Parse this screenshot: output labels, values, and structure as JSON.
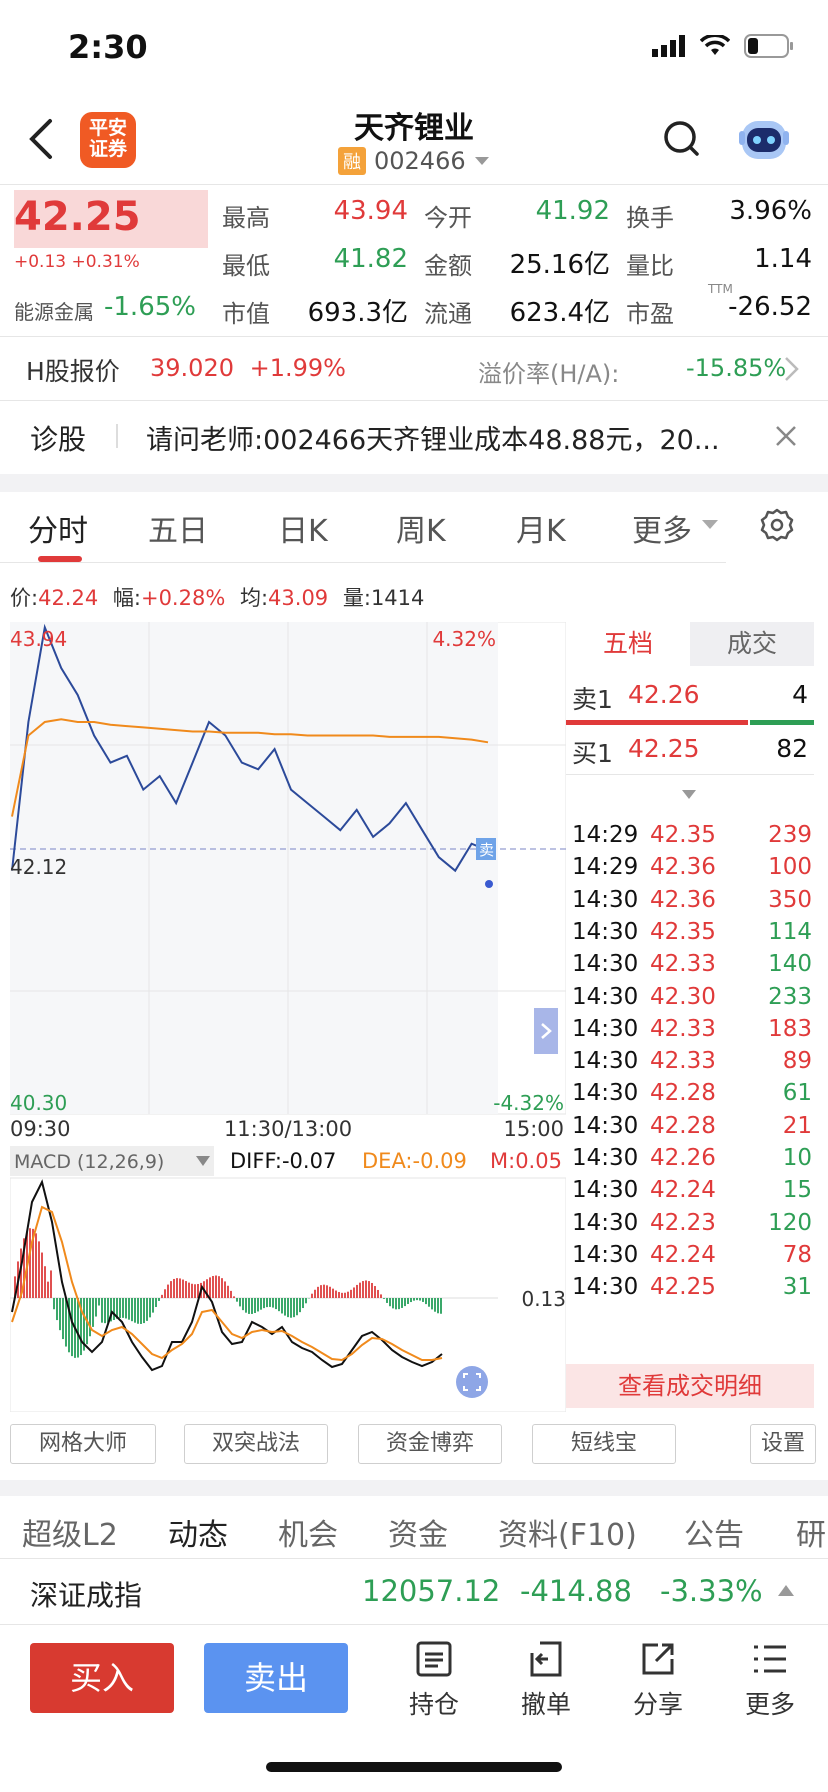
{
  "status": {
    "time": "2:30"
  },
  "header": {
    "title": "天齐锂业",
    "badge": "融",
    "code": "002466",
    "logo_line1": "平安",
    "logo_line2": "证券"
  },
  "quote": {
    "price": "42.25",
    "change": "+0.13 +0.31%",
    "sector_label": "能源金属",
    "sector_change": "-1.65%",
    "stats": [
      {
        "label": "最高",
        "value": "43.94",
        "color": "red"
      },
      {
        "label": "今开",
        "value": "41.92",
        "color": "green"
      },
      {
        "label": "换手",
        "value": "3.96%",
        "color": "black"
      },
      {
        "label": "最低",
        "value": "41.82",
        "color": "green"
      },
      {
        "label": "金额",
        "value": "25.16亿",
        "color": "black"
      },
      {
        "label": "量比",
        "value": "1.14",
        "color": "black"
      },
      {
        "label": "市值",
        "value": "693.3亿",
        "color": "black"
      },
      {
        "label": "流通",
        "value": "623.4亿",
        "color": "black"
      },
      {
        "label": "市盈",
        "value": "-26.52",
        "color": "black"
      }
    ],
    "pe_sup": "TTM"
  },
  "hshare": {
    "label": "H股报价",
    "price": "39.020",
    "change": "+1.99%",
    "premium_label": "溢价率(H/A):",
    "premium": "-15.85%"
  },
  "diagnosis": {
    "label": "诊股",
    "text": "请问老师:002466天齐锂业成本48.88元，20..."
  },
  "tabs": [
    "分时",
    "五日",
    "日K",
    "周K",
    "月K",
    "更多"
  ],
  "info_line": {
    "price_label": "价:",
    "price": "42.24",
    "amp_label": "幅:",
    "amp": "+0.28%",
    "avg_label": "均:",
    "avg": "43.09",
    "vol_label": "量:",
    "vol": "1414"
  },
  "chart": {
    "high": "43.94",
    "low": "40.30",
    "mid": "42.12",
    "pct_high": "4.32%",
    "pct_low": "-4.32%",
    "x_start": "09:30",
    "x_mid": "11:30/13:00",
    "x_end": "15:00",
    "sell_mark": "卖"
  },
  "chart_data": {
    "type": "line",
    "x_range": [
      "09:30",
      "15:00"
    ],
    "ylim": [
      40.3,
      43.94
    ],
    "series": [
      {
        "values": [
          42.1,
          43.2,
          43.9,
          43.6,
          43.4,
          43.1,
          42.9,
          42.95,
          42.7,
          42.8,
          42.6,
          42.9,
          43.2,
          43.1,
          42.9,
          42.85,
          43.0,
          42.7,
          42.6,
          42.5,
          42.4,
          42.55,
          42.35,
          42.45,
          42.6,
          42.4,
          42.2,
          42.1,
          42.3,
          42.25
        ]
      },
      {
        "values": [
          42.5,
          43.1,
          43.2,
          43.22,
          43.2,
          43.2,
          43.18,
          43.17,
          43.16,
          43.15,
          43.14,
          43.13,
          43.13,
          43.12,
          43.12,
          43.12,
          43.11,
          43.11,
          43.1,
          43.1,
          43.1,
          43.1,
          43.1,
          43.09,
          43.09,
          43.09,
          43.09,
          43.08,
          43.07,
          43.05
        ]
      }
    ]
  },
  "macd": {
    "label": "MACD (12,26,9)",
    "diff": "DIFF:-0.07",
    "dea": "DEA:-0.09",
    "m": "M:0.05",
    "level": "0.13"
  },
  "orderbook": {
    "tab1": "五档",
    "tab2": "成交",
    "sell1": {
      "label": "卖1",
      "price": "42.26",
      "vol": "4"
    },
    "buy1": {
      "label": "买1",
      "price": "42.25",
      "vol": "82"
    },
    "ticks": [
      {
        "t": "14:29",
        "p": "42.35",
        "v": "239",
        "c": "red"
      },
      {
        "t": "14:29",
        "p": "42.36",
        "v": "100",
        "c": "red"
      },
      {
        "t": "14:30",
        "p": "42.36",
        "v": "350",
        "c": "red"
      },
      {
        "t": "14:30",
        "p": "42.35",
        "v": "114",
        "c": "green"
      },
      {
        "t": "14:30",
        "p": "42.33",
        "v": "140",
        "c": "green"
      },
      {
        "t": "14:30",
        "p": "42.30",
        "v": "233",
        "c": "green"
      },
      {
        "t": "14:30",
        "p": "42.33",
        "v": "183",
        "c": "red"
      },
      {
        "t": "14:30",
        "p": "42.33",
        "v": "89",
        "c": "red"
      },
      {
        "t": "14:30",
        "p": "42.28",
        "v": "61",
        "c": "green"
      },
      {
        "t": "14:30",
        "p": "42.28",
        "v": "21",
        "c": "red"
      },
      {
        "t": "14:30",
        "p": "42.26",
        "v": "10",
        "c": "green"
      },
      {
        "t": "14:30",
        "p": "42.24",
        "v": "15",
        "c": "green"
      },
      {
        "t": "14:30",
        "p": "42.23",
        "v": "120",
        "c": "green"
      },
      {
        "t": "14:30",
        "p": "42.24",
        "v": "78",
        "c": "red"
      },
      {
        "t": "14:30",
        "p": "42.25",
        "v": "31",
        "c": "green"
      }
    ],
    "detail": "查看成交明细"
  },
  "tools": [
    "网格大师",
    "双突战法",
    "资金博弈",
    "短线宝",
    "设置"
  ],
  "news_tabs": [
    "超级L2",
    "动态",
    "机会",
    "资金",
    "资料(F10)",
    "公告",
    "研"
  ],
  "index": {
    "name": "深证成指",
    "value": "12057.12",
    "change": "-414.88",
    "pct": "-3.33%"
  },
  "bottom": {
    "buy": "买入",
    "sell": "卖出",
    "items": [
      "持仓",
      "撤单",
      "分享",
      "更多"
    ]
  },
  "colors": {
    "up": "#e03a3a",
    "down": "#2e9e55",
    "price_line": "#2c4a9a",
    "avg_line": "#f08a1c"
  }
}
